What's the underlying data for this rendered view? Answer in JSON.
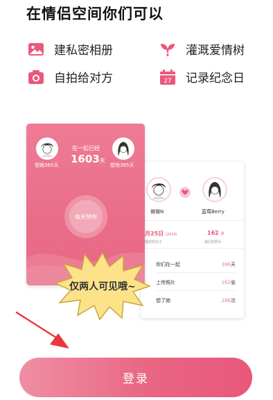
{
  "header": {
    "title": "在情侣空间你们可以"
  },
  "features": [
    {
      "label": "建私密相册",
      "icon": "photo-album-icon",
      "color": "#e9587c"
    },
    {
      "label": "灌溉爱情树",
      "icon": "sprout-icon",
      "color": "#e9587c"
    },
    {
      "label": "自拍给对方",
      "icon": "camera-icon",
      "color": "#e9587c"
    },
    {
      "label": "记录纪念日",
      "icon": "calendar-icon",
      "color": "#e9587c",
      "calendar_day": "27"
    }
  ],
  "left_card": {
    "together_label": "在一起已经",
    "days": "1603",
    "days_unit": "天",
    "miss_left": "想她365天",
    "miss_right": "想他365天",
    "miss_button": "每天想你"
  },
  "right_card": {
    "name_left": "微微N",
    "name_right": "蓝莓Berry",
    "stat_left_value": "月25日",
    "stat_left_tag": "(2018)",
    "stat_left_sub": "相恋的日子",
    "stat_right_value": "162",
    "stat_right_unit": "张",
    "stat_right_sub": "我们的照片",
    "rows": [
      {
        "label": "你们在一起",
        "value": "386",
        "unit": "天"
      },
      {
        "label": "上传照片",
        "value": "162",
        "unit": "张"
      },
      {
        "label": "想了她",
        "value": "286",
        "unit": "次"
      }
    ]
  },
  "burst_text": "仅两人可见哦~",
  "login_button": "登录",
  "colors": {
    "accent": "#e9587c",
    "card_pink": "#ea6d88",
    "burst_yellow": "#fce38a"
  }
}
